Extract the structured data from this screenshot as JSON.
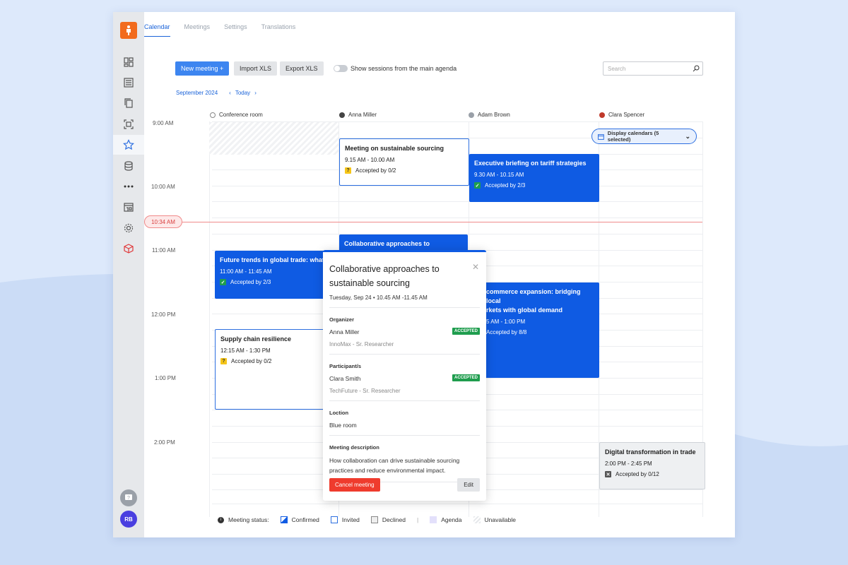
{
  "tabs": [
    "Calendar",
    "Meetings",
    "Settings",
    "Translations"
  ],
  "toolbar": {
    "new_meeting": "New meeting +",
    "import_xls": "Import XLS",
    "export_xls": "Export XLS",
    "toggle_label": "Show sessions from the main agenda",
    "search_placeholder": "Search"
  },
  "date_nav": {
    "month": "September 2024",
    "today": "Today"
  },
  "columns": [
    {
      "name": "Conference room"
    },
    {
      "name": "Anna Miller"
    },
    {
      "name": "Adam Brown"
    },
    {
      "name": "Clara Spencer"
    }
  ],
  "times": [
    "9:00 AM",
    "10:00 AM",
    "11:00 AM",
    "12:00 PM",
    "1:00 PM",
    "2:00 PM"
  ],
  "now": "10:34 AM",
  "display_calendars": "Display calendars (5 selected)",
  "events": {
    "sustainable": {
      "title": "Meeting on sustainable sourcing",
      "time": "9.15 AM - 10.00 AM",
      "status": "Accepted by 0/2"
    },
    "tariff": {
      "title": "Executive briefing on tariff strategies",
      "time": "9.30 AM - 10.15 AM",
      "status": "Accepted by 2/3"
    },
    "collab": {
      "title": "Collaborative approaches to"
    },
    "future": {
      "title": "Future trends in global trade: what",
      "time": "11:00 AM - 11:45 AM",
      "status": "Accepted by 2/3"
    },
    "ecommerce": {
      "title1": "commerce expansion: bridging local",
      "title2": "rkets with global demand",
      "time": "5 AM - 1:00 PM",
      "status": "Accepted by 8/8"
    },
    "supply": {
      "title": "Supply chain resilience",
      "time": "12:15 AM - 1:30 PM",
      "status": "Accepted by 0/2"
    },
    "digital": {
      "title": "Digital transformation in trade",
      "time": "2:00 PM - 2:45 PM",
      "status": "Accepted by 0/12"
    }
  },
  "popup": {
    "title": "Collaborative approaches to sustainable sourcing",
    "when": "Tuesday, Sep 24 • 10.45 AM -11.45 AM",
    "organizer_label": "Organizer",
    "organizer_name": "Anna Miller",
    "organizer_org": "InnoMax - Sr. Researcher",
    "participant_label": "Participant/s",
    "participant_name": "Clara Smith",
    "participant_org": "TechFuture - Sr. Researcher",
    "accepted": "ACCEPTED",
    "location_label": "Loction",
    "location": "Blue room",
    "description_label": "Meeting description",
    "description": "How collaboration can drive sustainable sourcing practices and reduce environmental impact.",
    "cancel": "Cancel meeting",
    "edit": "Edit"
  },
  "legend": {
    "label": "Meeting status:",
    "confirmed": "Confirmed",
    "invited": "Invited",
    "declined": "Declined",
    "sep": "|",
    "agenda": "Agenda",
    "unavailable": "Unavailable"
  },
  "user_initials": "RB",
  "colors": {
    "primary": "#0f5be3",
    "accent": "#3d85f0",
    "danger": "#ef3b2d",
    "brand": "#f26b1d",
    "success": "#1f9d4e"
  }
}
